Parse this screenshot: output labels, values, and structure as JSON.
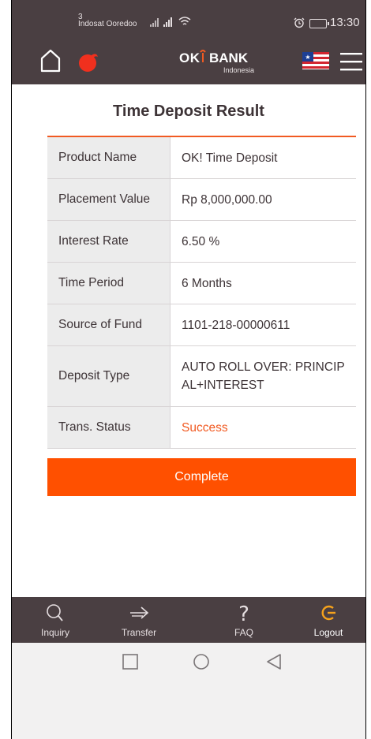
{
  "status_bar": {
    "carrier_slot": "3",
    "carrier_name": "Indosat Ooredoo",
    "time": "13:30"
  },
  "header": {
    "logo_ok": "OK",
    "logo_bank": "BANK",
    "logo_sub": "Indonesia",
    "icons": [
      "home-icon",
      "brand-badge-icon",
      "flag-icon",
      "menu-icon"
    ]
  },
  "page": {
    "title": "Time Deposit Result"
  },
  "result": {
    "rows": [
      {
        "label": "Product Name",
        "value": "OK! Time Deposit"
      },
      {
        "label": "Placement Value",
        "value": "Rp 8,000,000.00"
      },
      {
        "label": "Interest Rate",
        "value": "6.50 %"
      },
      {
        "label": "Time Period",
        "value": "6 Months"
      },
      {
        "label": "Source of Fund",
        "value": "1101-218-00000611"
      },
      {
        "label": "Deposit Type",
        "value": "AUTO ROLL OVER: PRINCIPAL+INTEREST"
      },
      {
        "label": "Trans. Status",
        "value": "Success"
      }
    ]
  },
  "actions": {
    "complete_label": "Complete"
  },
  "bottom_nav": {
    "items": [
      {
        "label": "Inquiry",
        "icon": "search-icon"
      },
      {
        "label": "Transfer",
        "icon": "arrow-right-icon"
      },
      {
        "label": "FAQ",
        "icon": "question-icon"
      },
      {
        "label": "Logout",
        "icon": "logout-icon"
      }
    ]
  },
  "colors": {
    "header_bg": "#4a3f42",
    "accent": "#ff5000",
    "success": "#f15a22",
    "label_bg": "#ececec"
  }
}
